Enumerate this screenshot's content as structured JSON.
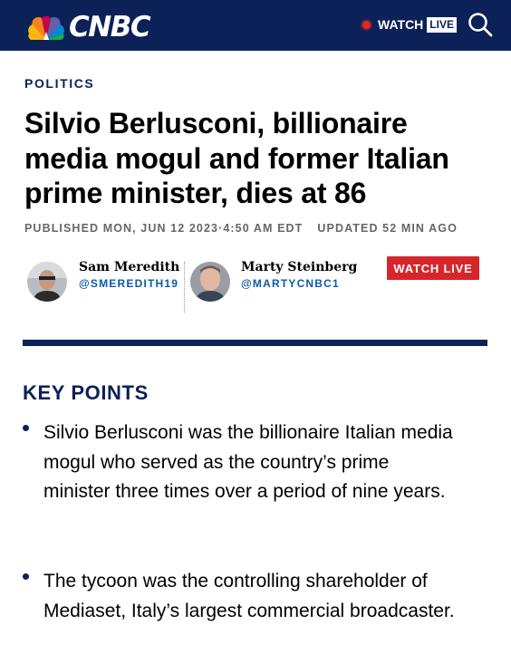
{
  "header": {
    "logo_text": "CNBC",
    "watch_label": "WATCH",
    "live_label": "LIVE",
    "colors": {
      "navy": "#0b2157",
      "red": "#d6262b",
      "link": "#0b5ba8"
    }
  },
  "article": {
    "section": "POLITICS",
    "headline": "Silvio Berlusconi, billionaire media mogul and former Italian prime minister, dies at 86",
    "published": "PUBLISHED MON, JUN 12 2023·4:50 AM EDT",
    "updated": "UPDATED 52 MIN AGO"
  },
  "authors": [
    {
      "name": "Sam Meredith",
      "handle": "@SMEREDITH19"
    },
    {
      "name": "Marty Steinberg",
      "handle": "@MARTYCNBC1"
    }
  ],
  "watch_live_button": "WATCH LIVE",
  "key_points": {
    "title": "KEY POINTS",
    "items": [
      "Silvio Berlusconi was the billionaire Italian media mogul who served as the country’s prime minister three times over a period of nine years.",
      "The tycoon was the controlling shareholder of Mediaset, Italy’s largest commercial broadcaster."
    ]
  }
}
